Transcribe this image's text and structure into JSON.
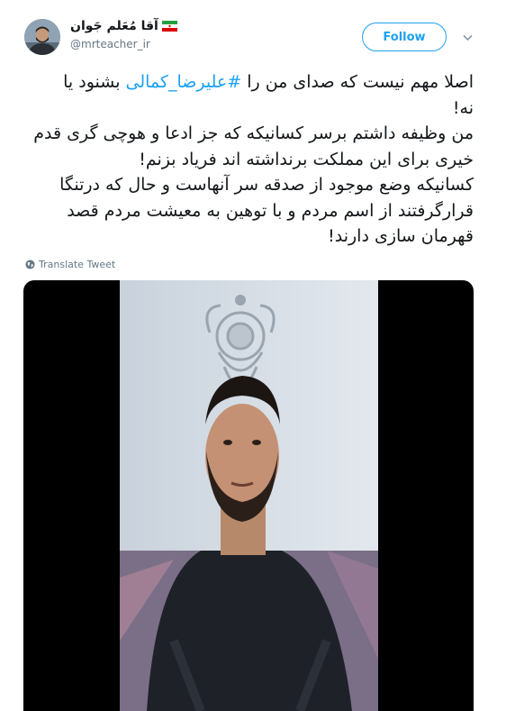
{
  "user": {
    "display_name": "آقا مُعَلم جَوان",
    "handle": "@mrteacher_ir",
    "flag_icon": "iran-flag-icon"
  },
  "follow_label": "Follow",
  "tweet": {
    "line1_hashtag": "#علیرضا_کمالی",
    "line1_before": "اصلا مهم نیست که صدای من را ",
    "line1_after": " بشنود یا",
    "line2": "نه!",
    "line3": "من وظیفه داشتم برسر کسانیکه که جز ادعا و هوچی گری قدم",
    "line4": "خیری برای این مملکت برنداشته اند فریاد بزنم!",
    "line5": "کسانیکه وضع موجود از صدقه سر آنهاست و حال که درتنگا",
    "line6": "قرارگرفتند از اسم مردم و با توهین به معیشت مردم قصد",
    "line7": "قهرمان سازی دارند!"
  },
  "translate_label": "Translate Tweet",
  "colors": {
    "accent": "#1da1f2",
    "muted": "#657786",
    "text": "#14171a"
  }
}
